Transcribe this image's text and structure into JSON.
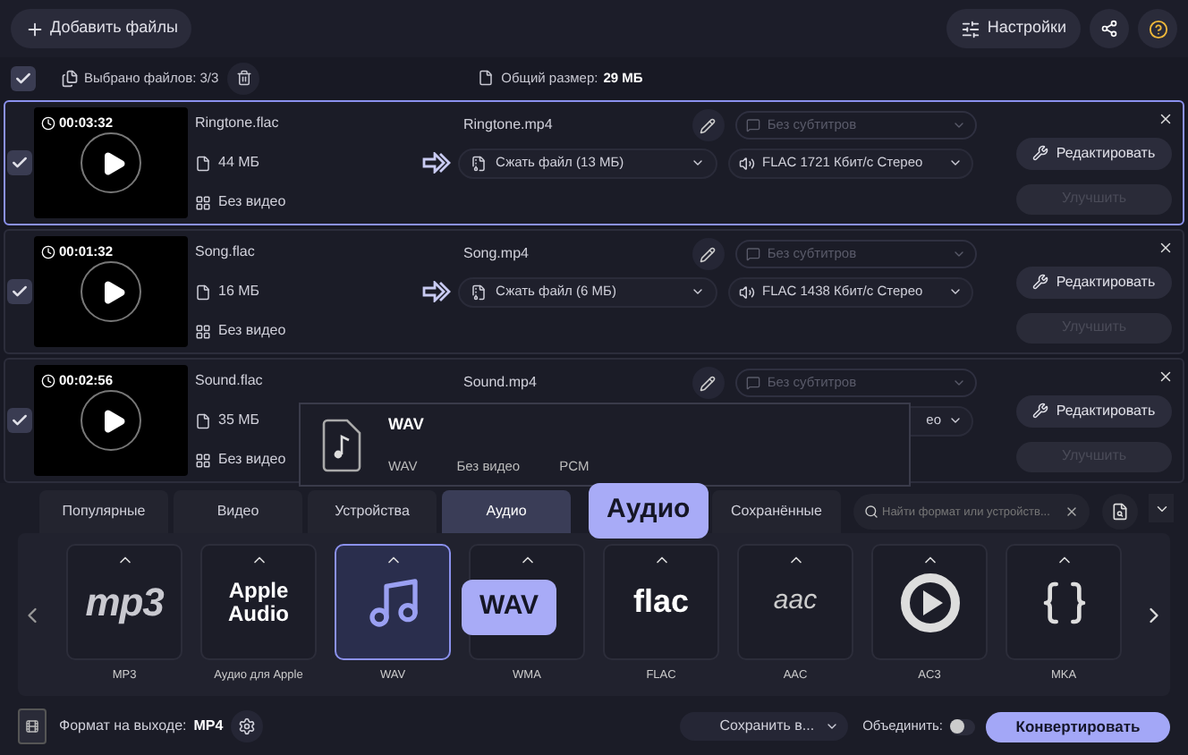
{
  "toolbar": {
    "add_files": "Добавить файлы",
    "settings": "Настройки"
  },
  "selection": {
    "checked": true,
    "selected_count": "Выбрано файлов: 3/3",
    "total_label": "Общий размер:",
    "total_value": "29 МБ"
  },
  "files": [
    {
      "selected": true,
      "checked": true,
      "duration": "00:03:32",
      "source_name": "Ringtone.flac",
      "size": "44 МБ",
      "video": "Без видео",
      "target_name": "Ringtone.mp4",
      "subtitles": "Без субтитров",
      "compression": "Сжать файл (13 МБ)",
      "audio": "FLAC 1721 Кбит/с Стерео",
      "edit": "Редактировать",
      "enhance": "Улучшить",
      "enhance_disabled": true
    },
    {
      "selected": false,
      "checked": true,
      "duration": "00:01:32",
      "source_name": "Song.flac",
      "size": "16 МБ",
      "video": "Без видео",
      "target_name": "Song.mp4",
      "subtitles": "Без субтитров",
      "compression": "Сжать файл (6 МБ)",
      "audio": "FLAC 1438 Кбит/с Стерео",
      "edit": "Редактировать",
      "enhance": "Улучшить",
      "enhance_disabled": true
    },
    {
      "selected": false,
      "checked": true,
      "duration": "00:02:56",
      "source_name": "Sound.flac",
      "size": "35 МБ",
      "video": "Без видео",
      "target_name": "Sound.mp4",
      "subtitles": "Без субтитров",
      "audio": "ео",
      "edit": "Редактировать",
      "enhance": "Улучшить",
      "enhance_disabled": true,
      "popup": {
        "title": "WAV",
        "details": [
          "WAV",
          "Без видео",
          "PCM"
        ]
      }
    }
  ],
  "format_tabs": [
    {
      "label": "Популярные",
      "selected": false
    },
    {
      "label": "Видео",
      "selected": false
    },
    {
      "label": "Устройства",
      "selected": false
    },
    {
      "label": "Аудио",
      "selected": true
    },
    {
      "label": "Сохранённые",
      "selected": false
    }
  ],
  "tab_tooltip": "Аудио",
  "search": {
    "placeholder": "Найти формат или устройств..."
  },
  "formats": [
    {
      "kind": "mp3",
      "logo_text": "mp3",
      "label": "MP3",
      "selected": false
    },
    {
      "kind": "apple",
      "logo_text": "Apple Audio",
      "label": "Аудио для Apple",
      "selected": false
    },
    {
      "kind": "note",
      "label": "WAV",
      "selected": true
    },
    {
      "kind": "hidden",
      "label": "WMA",
      "selected": false
    },
    {
      "kind": "flac",
      "logo_text": "flac",
      "label": "FLAC",
      "selected": false
    },
    {
      "kind": "aac",
      "logo_text": "aac",
      "label": "AAC",
      "selected": false
    },
    {
      "kind": "play",
      "label": "AC3",
      "selected": false
    },
    {
      "kind": "braces",
      "label": "MKA",
      "selected": false
    }
  ],
  "format_tooltip": "WAV",
  "footer": {
    "output_label": "Формат на выходе:",
    "output_value": "MP4",
    "save": "Сохранить в...",
    "merge_label": "Объединить:",
    "merge_on": false,
    "convert": "Конвертировать"
  }
}
